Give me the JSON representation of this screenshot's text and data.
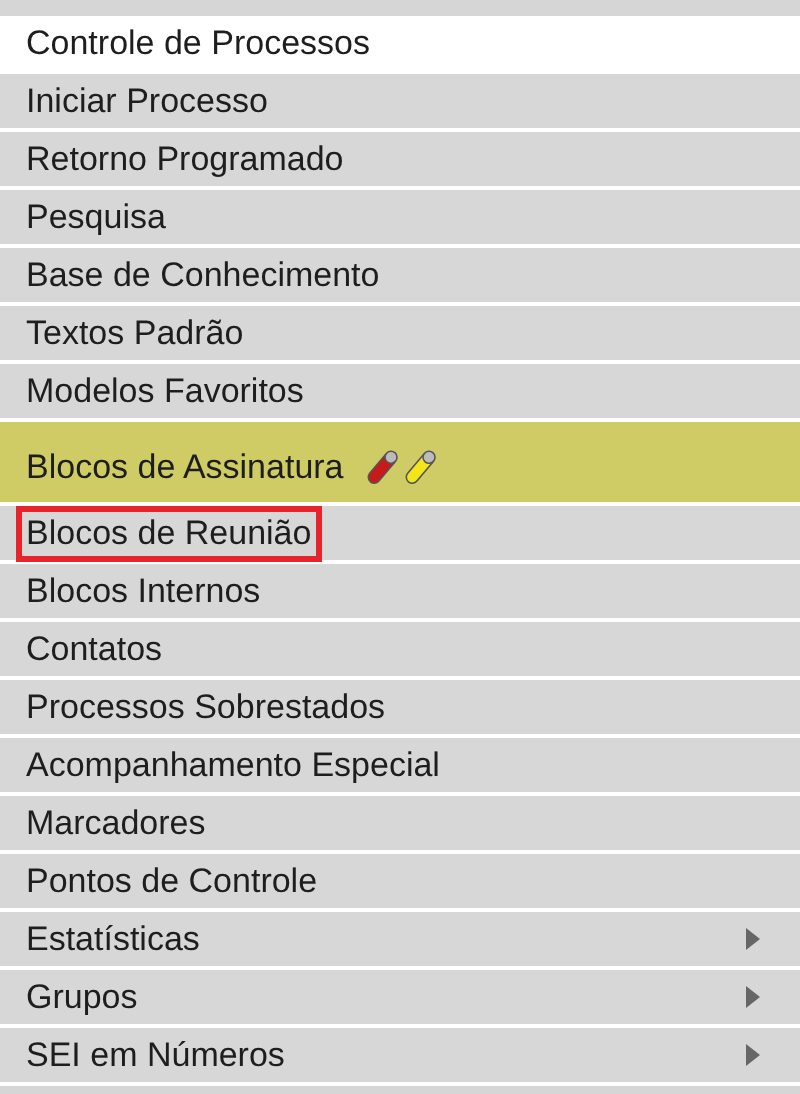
{
  "menu": {
    "items": [
      {
        "label": "Controle de Processos",
        "kind": "plain",
        "selected": true,
        "highlighted": false,
        "outlined": false
      },
      {
        "label": "Iniciar Processo",
        "kind": "plain",
        "selected": false,
        "highlighted": false,
        "outlined": false
      },
      {
        "label": "Retorno Programado",
        "kind": "plain",
        "selected": false,
        "highlighted": false,
        "outlined": false
      },
      {
        "label": "Pesquisa",
        "kind": "plain",
        "selected": false,
        "highlighted": false,
        "outlined": false
      },
      {
        "label": "Base de Conhecimento",
        "kind": "plain",
        "selected": false,
        "highlighted": false,
        "outlined": false
      },
      {
        "label": "Textos Padrão",
        "kind": "plain",
        "selected": false,
        "highlighted": false,
        "outlined": false
      },
      {
        "label": "Modelos Favoritos",
        "kind": "plain",
        "selected": false,
        "highlighted": false,
        "outlined": false
      },
      {
        "label": "Blocos de Assinatura",
        "kind": "pens",
        "selected": false,
        "highlighted": true,
        "outlined": false
      },
      {
        "label": "Blocos de Reunião",
        "kind": "plain",
        "selected": false,
        "highlighted": false,
        "outlined": true
      },
      {
        "label": "Blocos Internos",
        "kind": "plain",
        "selected": false,
        "highlighted": false,
        "outlined": false
      },
      {
        "label": "Contatos",
        "kind": "plain",
        "selected": false,
        "highlighted": false,
        "outlined": false
      },
      {
        "label": "Processos Sobrestados",
        "kind": "plain",
        "selected": false,
        "highlighted": false,
        "outlined": false
      },
      {
        "label": "Acompanhamento Especial",
        "kind": "plain",
        "selected": false,
        "highlighted": false,
        "outlined": false
      },
      {
        "label": "Marcadores",
        "kind": "plain",
        "selected": false,
        "highlighted": false,
        "outlined": false
      },
      {
        "label": "Pontos de Controle",
        "kind": "plain",
        "selected": false,
        "highlighted": false,
        "outlined": false
      },
      {
        "label": "Estatísticas",
        "kind": "submenu",
        "selected": false,
        "highlighted": false,
        "outlined": false
      },
      {
        "label": "Grupos",
        "kind": "submenu",
        "selected": false,
        "highlighted": false,
        "outlined": false
      },
      {
        "label": "SEI em Números",
        "kind": "submenu",
        "selected": false,
        "highlighted": false,
        "outlined": false
      }
    ]
  }
}
